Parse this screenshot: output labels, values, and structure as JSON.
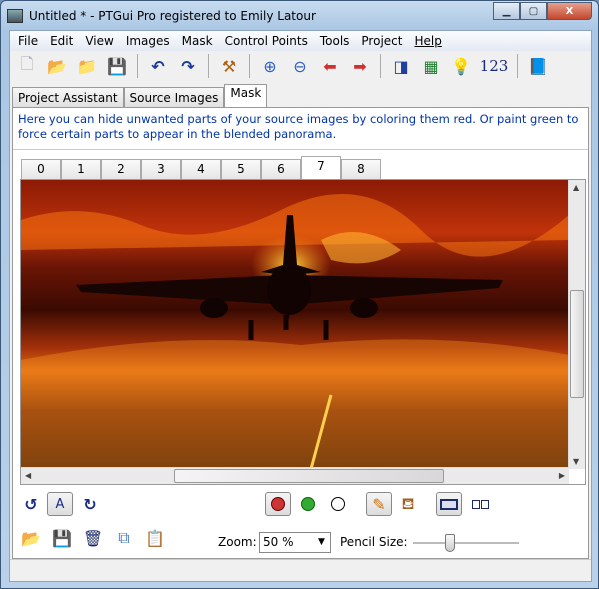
{
  "window": {
    "title": "Untitled * - PTGui Pro registered to Emily Latour"
  },
  "menu": [
    "File",
    "Edit",
    "View",
    "Images",
    "Mask",
    "Control Points",
    "Tools",
    "Project",
    "Help"
  ],
  "toolbar": {
    "numbers_label": "123",
    "icons": [
      "new-file-icon",
      "open-folder-icon",
      "open-images-icon",
      "save-icon",
      "undo-icon",
      "redo-icon",
      "tools-icon",
      "zoom-in-icon",
      "zoom-out-icon",
      "previous-icon",
      "next-icon",
      "panorama-editor-icon",
      "table-icon",
      "tips-icon",
      "numbers-icon",
      "help-book-icon"
    ]
  },
  "main_tabs": [
    {
      "label": "Project Assistant"
    },
    {
      "label": "Source Images"
    },
    {
      "label": "Mask",
      "active": true
    }
  ],
  "description": "Here you can hide unwanted parts of your source images by coloring them red. Or paint green to force certain parts to appear in the blended panorama.",
  "image_tabs": [
    "0",
    "1",
    "2",
    "3",
    "4",
    "5",
    "6",
    "7",
    "8"
  ],
  "active_image_tab": "7",
  "mask_tools": {
    "auto_label": "A",
    "zoom_label": "Zoom:",
    "zoom_value": "50 %",
    "pencil_label": "Pencil Size:",
    "pencil_size_percent": 35,
    "selected_color": "red",
    "selected_tool": "pencil"
  },
  "colors": {
    "description_text": "#0033aa",
    "mask_red": "#cc3333",
    "mask_green": "#33aa33"
  }
}
